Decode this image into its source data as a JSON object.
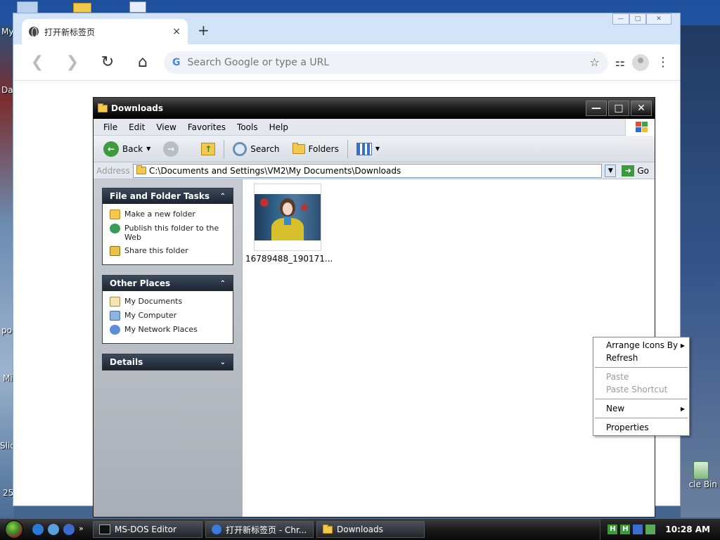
{
  "desktop": {
    "fragments": [
      "My",
      "Da",
      "po",
      "Mi",
      "Slic",
      "25"
    ]
  },
  "chrome": {
    "tab_title": "打开新标签页",
    "tab_close": "×",
    "new_tab": "+",
    "controls": [
      "—",
      "□",
      "✕"
    ],
    "omnibox_placeholder": "Search Google or type a URL",
    "g_logo": "G"
  },
  "explorer": {
    "title": "Downloads",
    "controls": [
      "—",
      "□",
      "✕"
    ],
    "menu": [
      "File",
      "Edit",
      "View",
      "Favorites",
      "Tools",
      "Help"
    ],
    "toolbar": {
      "back": "Back",
      "search": "Search",
      "folders": "Folders"
    },
    "address": {
      "label": "Address",
      "path": "C:\\Documents and Settings\\VM2\\My Documents\\Downloads",
      "go": "Go"
    },
    "file_tasks": {
      "title": "File and Folder Tasks",
      "items": [
        "Make a new folder",
        "Publish this folder to the Web",
        "Share this folder"
      ]
    },
    "other_places": {
      "title": "Other Places",
      "items": [
        "My Documents",
        "My Computer",
        "My Network Places"
      ]
    },
    "details": {
      "title": "Details"
    },
    "files": [
      {
        "name": "16789488_190171..."
      }
    ]
  },
  "context_menu": {
    "items": [
      "Arrange Icons By",
      "Refresh",
      "Paste",
      "Paste Shortcut",
      "New",
      "Properties"
    ]
  },
  "recycle_bin": {
    "label": "cle Bin"
  },
  "taskbar": {
    "tasks": [
      "MS-DOS Editor",
      "打开新标签页 - Chr...",
      "Downloads"
    ],
    "clock": "10:28 AM"
  }
}
